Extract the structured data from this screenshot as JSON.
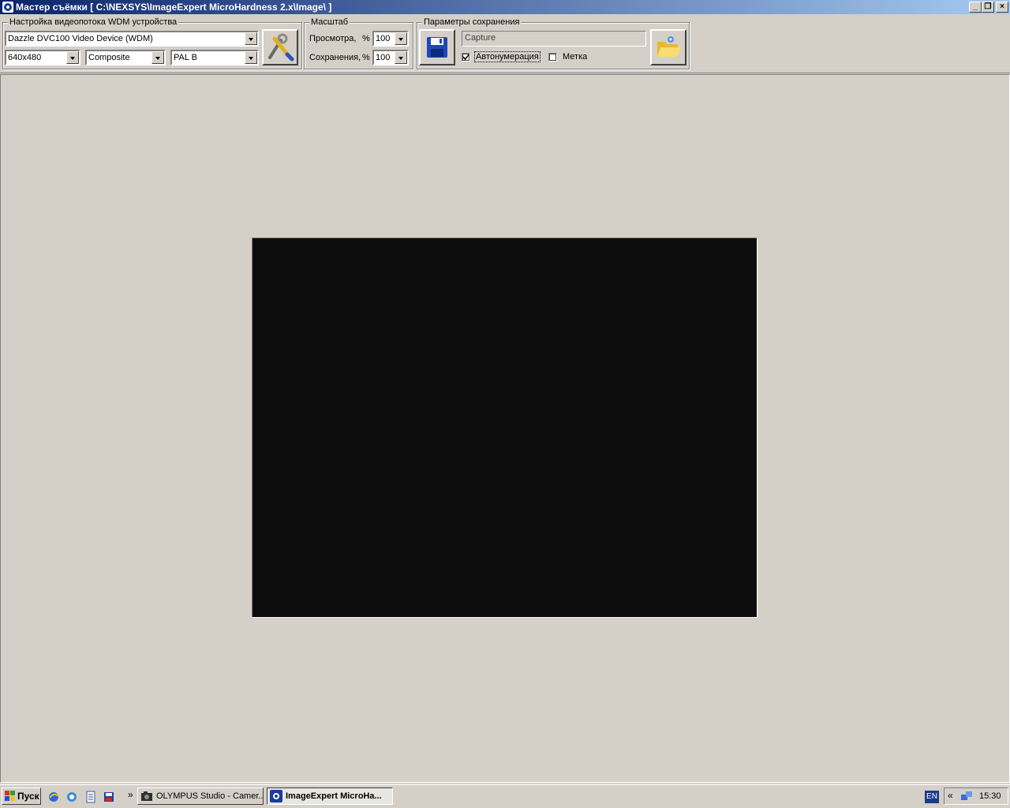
{
  "window": {
    "title": "Мастер съёмки [ C:\\NEXSYS\\ImageExpert MicroHardness 2.x\\Image\\ ]",
    "minimize_glyph": "_",
    "restore_glyph": "❐",
    "close_glyph": "×"
  },
  "video_settings": {
    "group_label": "Настройка видеопотока WDM устройства",
    "device": "Dazzle DVC100 Video Device (WDM)",
    "resolution": "640x480",
    "input": "Composite",
    "standard": "PAL B",
    "settings_icon": "tools-icon"
  },
  "scale": {
    "group_label": "Масштаб",
    "preview_label": "Просмотра,",
    "preview_unit": "%",
    "preview_value": "100",
    "save_label": "Сохранения,",
    "save_unit": "%",
    "save_value": "100"
  },
  "save_params": {
    "group_label": "Параметры сохранения",
    "filename": "Capture",
    "autonumber_label": "Автонумерация",
    "autonumber_checked": true,
    "mark_label": "Метка",
    "mark_checked": false,
    "save_icon": "floppy-disk-icon",
    "folder_icon": "open-folder-icon"
  },
  "taskbar": {
    "start_label": "Пуск",
    "chevron": "»",
    "tasks": [
      {
        "label": "OLYMPUS Studio - Camer..."
      },
      {
        "label": "ImageExpert MicroHa..."
      }
    ],
    "lang": "EN",
    "tray_chevron": "«",
    "clock": "15:30"
  },
  "colors": {
    "titlebar_start": "#0a246a",
    "titlebar_end": "#a6caf0",
    "face": "#d4d0c8",
    "preview_bg": "#0c0c0c"
  }
}
